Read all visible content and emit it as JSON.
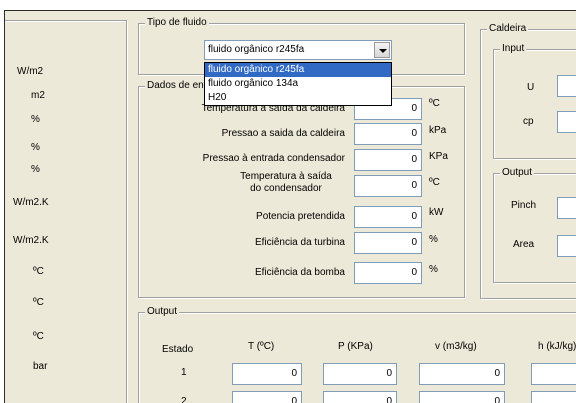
{
  "left_units": [
    "W/m2",
    "m2",
    "%",
    "%",
    "%",
    "W/m2.K",
    "W/m2.K",
    "ºC",
    "ºC",
    "ºC",
    "bar"
  ],
  "fluid_group": {
    "title": "Tipo de fluido",
    "selected": "fluido orgânico r245fa",
    "options": [
      "fluido orgânico r245fa",
      "fluido orgânico 134a",
      "H20"
    ]
  },
  "data_group": {
    "title": "Dados de entrada",
    "rows": [
      {
        "label": "Temperatura à saída da caldeira",
        "value": "0",
        "unit": "ºC"
      },
      {
        "label": "Pressao a saida da caldeira",
        "value": "0",
        "unit": "kPa"
      },
      {
        "label": "Pressao à entrada condensador",
        "value": "0",
        "unit": "KPa"
      },
      {
        "label1": "Temperatura à saída",
        "label2": "do condensador",
        "value": "0",
        "unit": "ºC"
      },
      {
        "label": "Potencia pretendida",
        "value": "0",
        "unit": "kW"
      },
      {
        "label": "Eficiência da turbina",
        "value": "0",
        "unit": "%"
      },
      {
        "label": "Eficiência da bomba",
        "value": "0",
        "unit": "%"
      }
    ]
  },
  "caldeira_group": {
    "title": "Caldeira",
    "input_title": "Input",
    "input_labels": [
      "U",
      "cp"
    ],
    "output_title": "Output",
    "output_labels": [
      "Pinch",
      "Area"
    ]
  },
  "output_group": {
    "title": "Output",
    "headers": [
      "Estado",
      "T (ºC)",
      "P (KPa)",
      "v (m3/kg)",
      "h (kJ/kg)"
    ],
    "rows": [
      {
        "estado": "1",
        "values": [
          "0",
          "0",
          "0"
        ]
      },
      {
        "estado": "2",
        "values": [
          "0",
          "0",
          "0"
        ]
      }
    ]
  }
}
